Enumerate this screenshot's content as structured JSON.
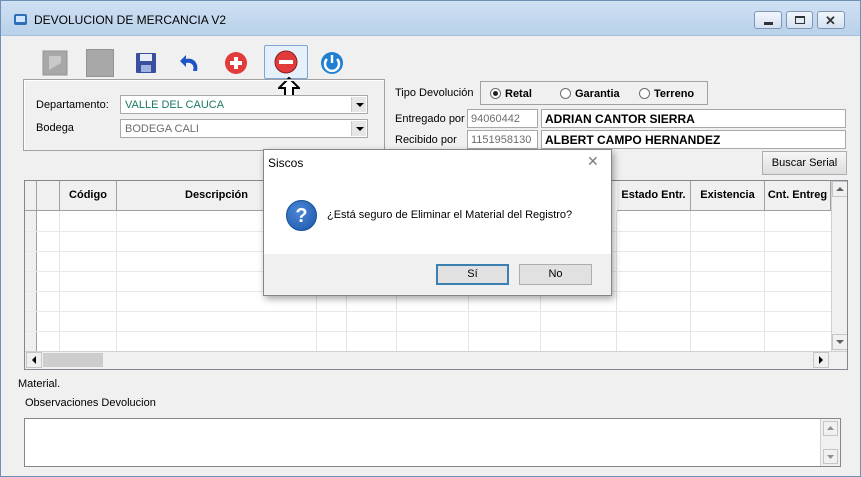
{
  "window": {
    "title": "DEVOLUCION DE MERCANCIA V2"
  },
  "toolbar": {
    "buttons": [
      "new",
      "blank",
      "save-icon",
      "undo-icon",
      "add-icon",
      "remove-icon",
      "power-icon"
    ],
    "selected": "remove-icon"
  },
  "filters": {
    "departamento_label": "Departamento:",
    "departamento_value": "VALLE DEL CAUCA",
    "bodega_label": "Bodega",
    "bodega_value": "BODEGA CALI"
  },
  "tipo": {
    "label": "Tipo Devolución",
    "options": [
      {
        "label": "Retal",
        "selected": true
      },
      {
        "label": "Garantia",
        "selected": false
      },
      {
        "label": "Terreno",
        "selected": false
      }
    ]
  },
  "entregado": {
    "label": "Entregado por",
    "id": "94060442",
    "name": "ADRIAN CANTOR SIERRA"
  },
  "recibido": {
    "label": "Recibido por",
    "id": "1151958130",
    "name": "ALBERT CAMPO HERNANDEZ"
  },
  "buscar_serial": "Buscar Serial",
  "grid": {
    "headers": [
      "Código",
      "Descripción",
      "Estado Entr.",
      "Existencia",
      "Cnt. Entreg"
    ]
  },
  "material_label": "Material.",
  "observaciones_label": "Observaciones Devolucion",
  "dialog": {
    "title": "Siscos",
    "message": "¿Está seguro de Eliminar el Material del Registro?",
    "yes": "Sí",
    "no": "No"
  },
  "colors": {
    "accent": "#3c7fb1",
    "combo_text": "#1a7a63"
  }
}
